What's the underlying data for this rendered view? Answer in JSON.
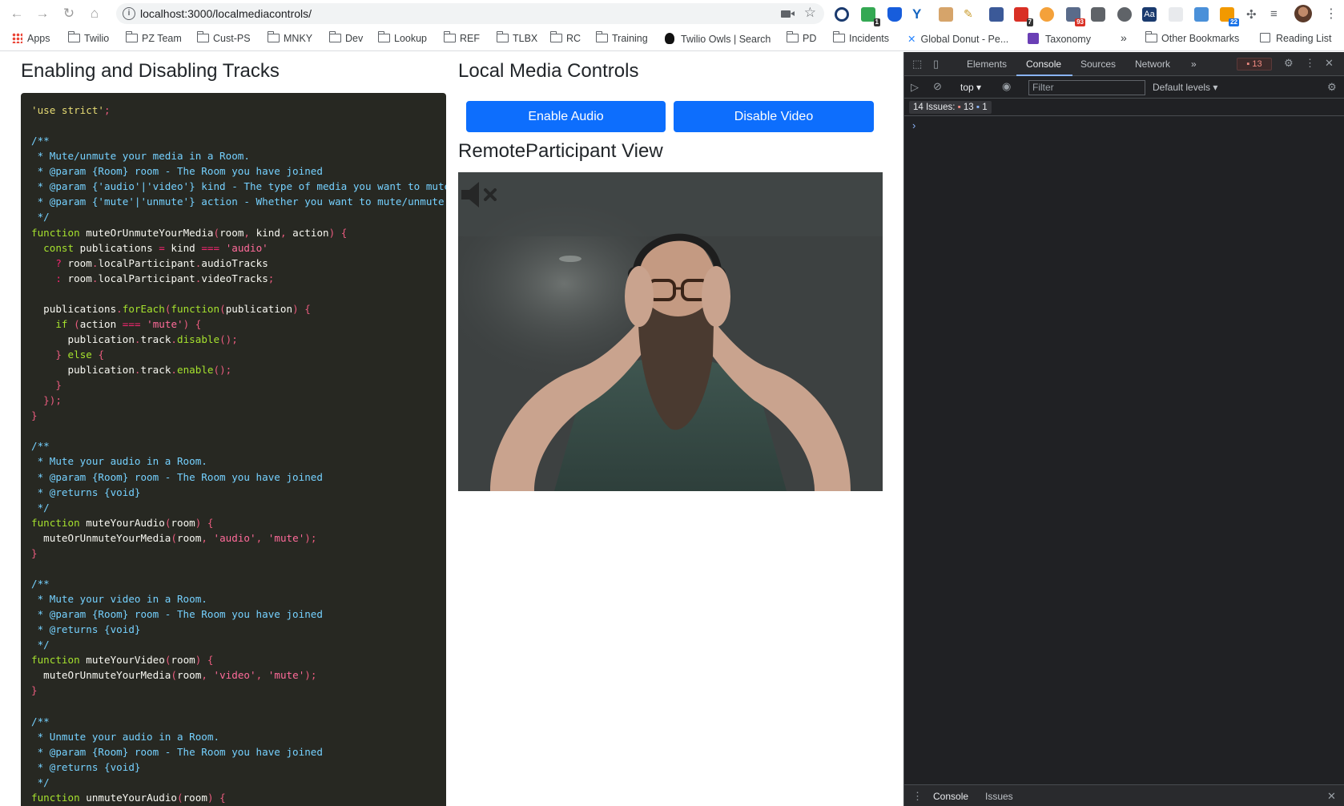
{
  "browser": {
    "url": "localhost:3000/localmediacontrols/",
    "bookmarks": [
      {
        "label": "Apps",
        "icon": "apps-grid-icon"
      },
      {
        "label": "Twilio",
        "icon": "folder-icon"
      },
      {
        "label": "PZ Team",
        "icon": "folder-icon"
      },
      {
        "label": "Cust-PS",
        "icon": "folder-icon"
      },
      {
        "label": "MNKY",
        "icon": "folder-icon"
      },
      {
        "label": "Dev",
        "icon": "folder-icon"
      },
      {
        "label": "Lookup",
        "icon": "folder-icon"
      },
      {
        "label": "REF",
        "icon": "folder-icon"
      },
      {
        "label": "TLBX",
        "icon": "folder-icon"
      },
      {
        "label": "RC",
        "icon": "folder-icon"
      },
      {
        "label": "Training",
        "icon": "folder-icon"
      },
      {
        "label": "Twilio Owls | Search",
        "icon": "owl-icon"
      },
      {
        "label": "PD",
        "icon": "folder-icon"
      },
      {
        "label": "Incidents",
        "icon": "folder-icon"
      },
      {
        "label": "Global Donut - Pe...",
        "icon": "confluence-icon"
      },
      {
        "label": "Taxonomy",
        "icon": "list-icon"
      },
      {
        "label": "»",
        "icon": "overflow-chevron-icon"
      },
      {
        "label": "Other Bookmarks",
        "icon": "folder-icon"
      },
      {
        "label": "Reading List",
        "icon": "reading-list-icon"
      }
    ],
    "extension_badges": {
      "ext_1": "1",
      "ext_2": "7",
      "ext_3": "93",
      "ext_4": "22"
    }
  },
  "page": {
    "left_heading": "Enabling and Disabling Tracks",
    "right_heading": "Local Media Controls",
    "buttons": {
      "audio": "Enable Audio",
      "video": "Disable Video"
    },
    "remote_heading": "RemoteParticipant View",
    "accent_color": "#0d6efd",
    "code_background": "#272822"
  },
  "devtools": {
    "tabs": [
      "Elements",
      "Console",
      "Sources",
      "Network",
      "»"
    ],
    "active_tab": "Console",
    "error_count": "13",
    "context": "top",
    "filter_placeholder": "Filter",
    "levels": "Default levels",
    "issues_label": "14 Issues:",
    "issues_errors": "13",
    "issues_info": "1",
    "drawer_tabs": [
      "Console",
      "Issues"
    ]
  }
}
